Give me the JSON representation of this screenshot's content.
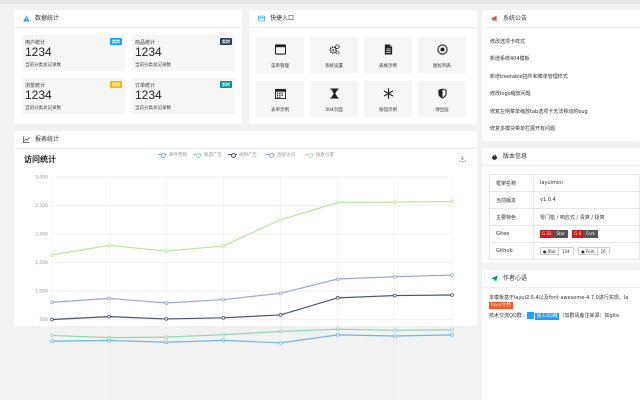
{
  "cards": {
    "stats_title": "数据统计",
    "quick_title": "快捷入口",
    "notice_title": "系统公告",
    "report_title": "报表统计",
    "version_title": "版本信息",
    "author_title": "作者心语"
  },
  "stats": [
    {
      "label": "用户统计",
      "badge": "实时",
      "badge_color": "#1e9fff",
      "value": "1234",
      "sub": "当前分类总记录数"
    },
    {
      "label": "商品统计",
      "badge": "实时",
      "badge_color": "#2f4056",
      "value": "1234",
      "sub": "当前分类总记录数"
    },
    {
      "label": "浏览统计",
      "badge": "实时",
      "badge_color": "#ffb800",
      "value": "1234",
      "sub": "当前分类总记录数"
    },
    {
      "label": "订单统计",
      "badge": "实时",
      "badge_color": "#009688",
      "value": "1234",
      "sub": "当前分类总记录数"
    }
  ],
  "quick": [
    {
      "label": "菜单管理",
      "icon": "window-icon"
    },
    {
      "label": "系统设置",
      "icon": "gears-icon"
    },
    {
      "label": "表格示例",
      "icon": "file-icon"
    },
    {
      "label": "图标列表",
      "icon": "dot-circle-icon"
    },
    {
      "label": "表单示例",
      "icon": "calendar-icon"
    },
    {
      "label": "404页面",
      "icon": "hourglass-icon"
    },
    {
      "label": "按钮示例",
      "icon": "snowflake-icon"
    },
    {
      "label": "弹出层",
      "icon": "shield-icon"
    }
  ],
  "notices": [
    "修改选项卡样式",
    "新增系统404模板",
    "新增treetable插件和菜单管理样式",
    "修改logo缩放问题",
    "修复左侧菜单缩放tab选项卡无法移动的bug",
    "修复多模块菜单栏展开有问题"
  ],
  "chart_data": {
    "type": "line",
    "title": "访问统计",
    "categories": [
      "",
      "",
      "",
      "",
      "",
      "",
      "",
      ""
    ],
    "series": [
      {
        "name": "邮件营销",
        "color": "#6fb5e0",
        "values": [
          120,
          132,
          101,
          134,
          90,
          230,
          210,
          230
        ]
      },
      {
        "name": "联盟广告",
        "color": "#91d5b8",
        "values": [
          220,
          182,
          191,
          234,
          290,
          330,
          310,
          320
        ]
      },
      {
        "name": "视频广告",
        "color": "#4a5270",
        "values": [
          500,
          550,
          510,
          530,
          580,
          880,
          920,
          930
        ]
      },
      {
        "name": "直接访问",
        "color": "#9aa6d4",
        "values": [
          800,
          870,
          790,
          850,
          960,
          1210,
          1250,
          1280
        ]
      },
      {
        "name": "搜索引擎",
        "color": "#bde3a0",
        "values": [
          1630,
          1800,
          1700,
          1790,
          2250,
          2550,
          2560,
          2570
        ]
      }
    ],
    "y_ticks": [
      "3,000",
      "2,500",
      "2,000",
      "1,500",
      "1,000",
      "500"
    ],
    "ylim": [
      0,
      3000
    ],
    "grid": true
  },
  "version": [
    {
      "key": "框架名称",
      "value": "layuimini"
    },
    {
      "key": "当前版本",
      "value": "v1.0.4"
    },
    {
      "key": "主要特色",
      "value": "零门槛 / 响应式 / 清爽 / 极简"
    }
  ],
  "version_gitee": {
    "key": "Gitee",
    "star_label": "Star",
    "star_count": "31",
    "fork_label": "Fork",
    "fork_count": "6"
  },
  "version_github": {
    "key": "Github",
    "star_label": "Star",
    "star_count": "134",
    "fork_label": "Fork",
    "fork_count": "16"
  },
  "author": {
    "line1": "本模板基于layui2.5.4以及font-awesome-4.7.0进行实现。la",
    "tag1": "layui文档",
    "line2_prefix": "技术交流QQ群：",
    "qq_tag": "加入QQ群",
    "line2_suffix": "（加群请备注来源：如gite"
  }
}
